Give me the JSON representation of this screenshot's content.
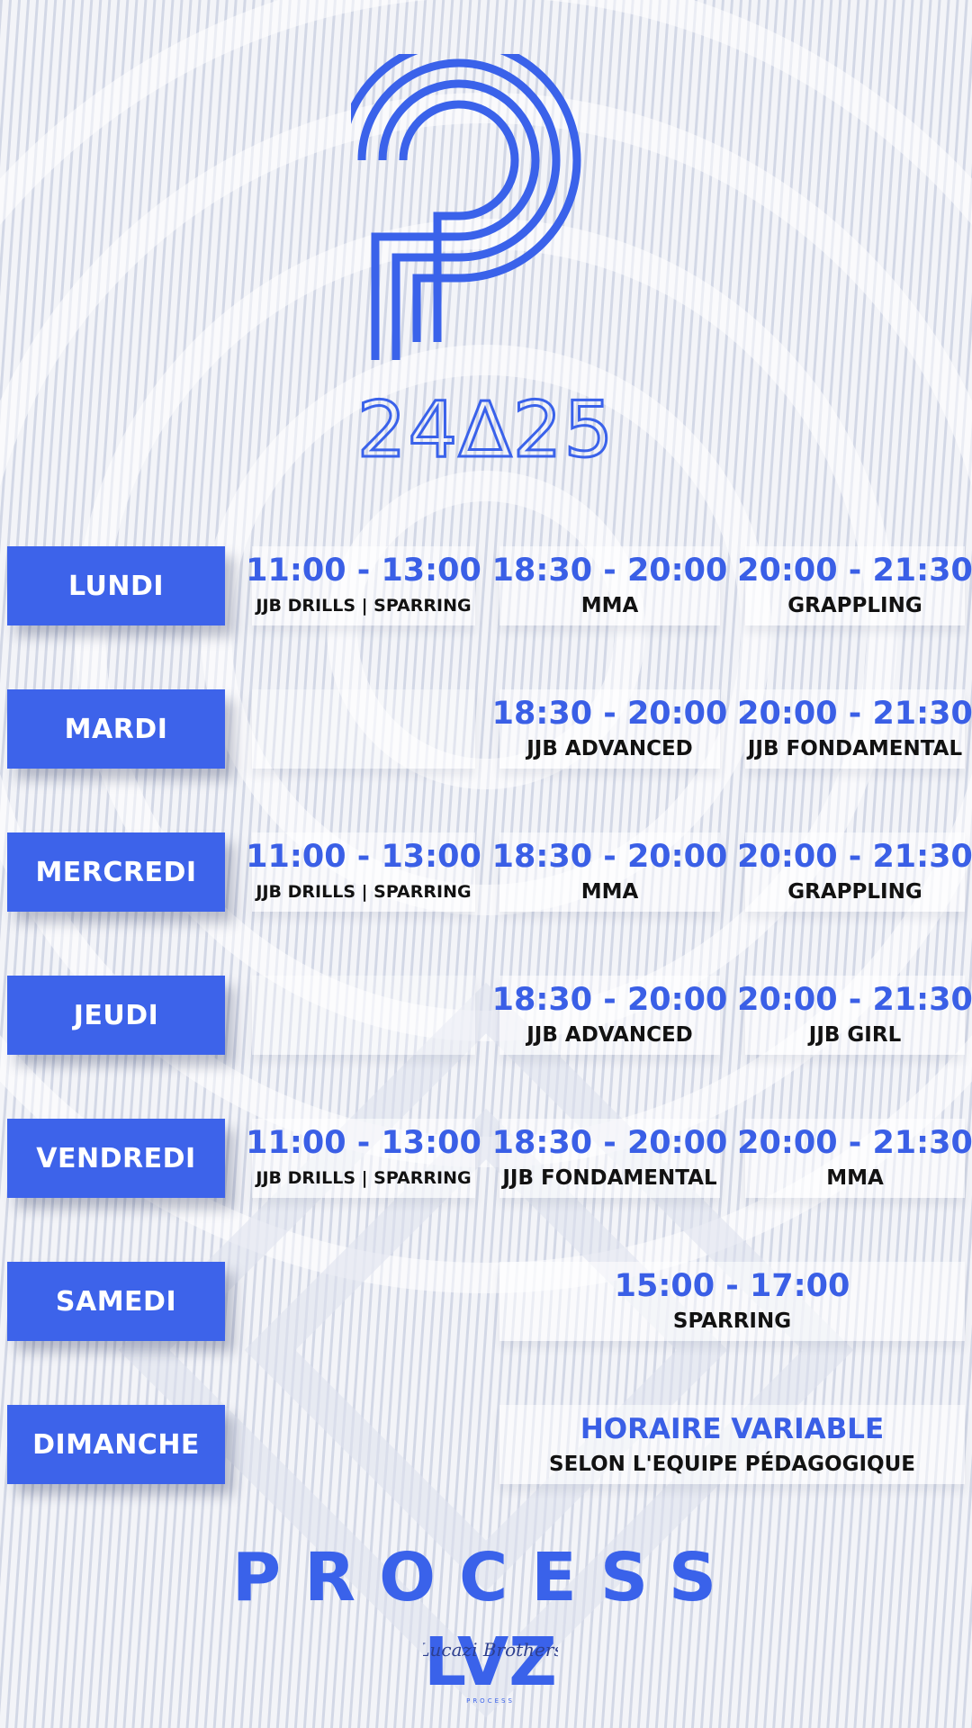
{
  "theme": {
    "accent": "#3d63ea",
    "text_dark": "#121212"
  },
  "season_label": "24∆25",
  "brand": {
    "name": "PROCESS",
    "sub_logo_text": "LVZ",
    "sub_logo_script": "Lucazi Brothers",
    "sub_logo_caption": "PROCESS"
  },
  "schedule": [
    {
      "day": "LUNDI",
      "slots": [
        {
          "time": "11:00 - 13:00",
          "class": "JJB DRILLS | SPARRING"
        },
        {
          "time": "18:30 - 20:00",
          "class": "MMA"
        },
        {
          "time": "20:00 - 21:30",
          "class": "GRAPPLING"
        }
      ]
    },
    {
      "day": "MARDI",
      "slots": [
        null,
        {
          "time": "18:30 - 20:00",
          "class": "JJB ADVANCED"
        },
        {
          "time": "20:00 - 21:30",
          "class": "JJB FONDAMENTAL"
        }
      ]
    },
    {
      "day": "MERCREDI",
      "slots": [
        {
          "time": "11:00 - 13:00",
          "class": "JJB DRILLS | SPARRING"
        },
        {
          "time": "18:30 - 20:00",
          "class": "MMA"
        },
        {
          "time": "20:00 - 21:30",
          "class": "GRAPPLING"
        }
      ]
    },
    {
      "day": "JEUDI",
      "slots": [
        null,
        {
          "time": "18:30 - 20:00",
          "class": "JJB ADVANCED"
        },
        {
          "time": "20:00 - 21:30",
          "class": "JJB GIRL"
        }
      ]
    },
    {
      "day": "VENDREDI",
      "slots": [
        {
          "time": "11:00 - 13:00",
          "class": "JJB DRILLS | SPARRING"
        },
        {
          "time": "18:30 - 20:00",
          "class": "JJB FONDAMENTAL"
        },
        {
          "time": "20:00 - 21:30",
          "class": "MMA"
        }
      ]
    },
    {
      "day": "SAMEDI",
      "wide": {
        "time": "15:00 - 17:00",
        "class": "SPARRING"
      }
    },
    {
      "day": "DIMANCHE",
      "wide": {
        "time": "HORAIRE VARIABLE",
        "class": "SELON L'EQUIPE PÉDAGOGIQUE"
      }
    }
  ]
}
